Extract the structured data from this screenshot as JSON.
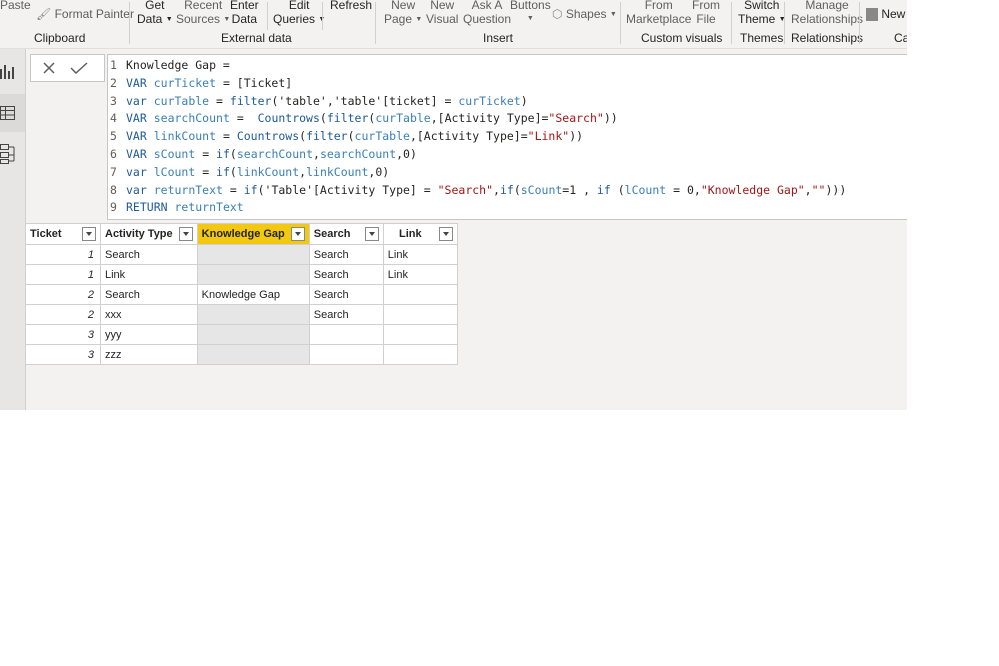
{
  "ribbon": {
    "paste": "Paste",
    "format_painter": "Format Painter",
    "get_data": [
      "Get",
      "Data"
    ],
    "recent_sources": [
      "Recent",
      "Sources"
    ],
    "enter_data": [
      "Enter",
      "Data"
    ],
    "edit_queries": [
      "Edit",
      "Queries"
    ],
    "refresh": "Refresh",
    "new_page": [
      "New",
      "Page"
    ],
    "new_visual": [
      "New",
      "Visual"
    ],
    "ask_question": [
      "Ask A",
      "Question"
    ],
    "buttons": "Buttons",
    "shapes": "Shapes",
    "from_marketplace": [
      "From",
      "Marketplace"
    ],
    "from_file": [
      "From",
      "File"
    ],
    "switch_theme": [
      "Switch",
      "Theme"
    ],
    "manage_relationships": [
      "Manage",
      "Relationships"
    ],
    "new": "New",
    "groups": {
      "clipboard": "Clipboard",
      "external_data": "External data",
      "insert": "Insert",
      "custom_visuals": "Custom visuals",
      "themes": "Themes",
      "relationships": "Relationships",
      "calc": "Ca"
    }
  },
  "nav": {
    "active": "data-view"
  },
  "formula": {
    "lines": [
      {
        "n": "1",
        "html": "Knowledge Gap ="
      },
      {
        "n": "2",
        "html": "<span class='kw'>VAR</span> <span class='var'>curTicket</span> = [Ticket]"
      },
      {
        "n": "3",
        "html": "<span class='kw'>var</span> <span class='var'>curTable</span> = <span class='fn'>filter</span>('table','table'[ticket] = <span class='var'>curTicket</span>)"
      },
      {
        "n": "4",
        "html": "<span class='kw'>VAR</span> <span class='var'>searchCount</span> =  <span class='fn'>Countrows</span>(<span class='fn'>filter</span>(<span class='var'>curTable</span>,[Activity Type]=<span class='str'>\"Search\"</span>))"
      },
      {
        "n": "5",
        "html": "<span class='kw'>VAR</span> <span class='var'>linkCount</span> = <span class='fn'>Countrows</span>(<span class='fn'>filter</span>(<span class='var'>curTable</span>,[Activity Type]=<span class='str'>\"Link\"</span>))"
      },
      {
        "n": "6",
        "html": "<span class='kw'>VAR</span> <span class='var'>sCount</span> = <span class='fn'>if</span>(<span class='var'>searchCount</span>,<span class='var'>searchCount</span>,0)"
      },
      {
        "n": "7",
        "html": "<span class='kw'>var</span> <span class='var'>lCount</span> = <span class='fn'>if</span>(<span class='var'>linkCount</span>,<span class='var'>linkCount</span>,0)"
      },
      {
        "n": "8",
        "html": "<span class='kw'>var</span> <span class='var'>returnText</span> = <span class='fn'>if</span>('Table'[Activity Type] = <span class='str'>\"Search\"</span>,<span class='fn'>if</span>(<span class='var'>sCount</span>=1 , <span class='fn'>if</span> (<span class='var'>lCount</span> = 0,<span class='str'>\"Knowledge Gap\"</span>,<span class='str'>\"\"</span>)))"
      },
      {
        "n": "9",
        "html": "<span class='kw'>RETURN</span> <span class='var'>returnText</span>"
      }
    ]
  },
  "table": {
    "columns": [
      "Ticket",
      "Activity Type",
      "Knowledge Gap",
      "Search",
      "Link"
    ],
    "rows": [
      [
        "1",
        "Search",
        "",
        "Search",
        "Link"
      ],
      [
        "1",
        "Link",
        "",
        "Search",
        "Link"
      ],
      [
        "2",
        "Search",
        "Knowledge Gap",
        "Search",
        ""
      ],
      [
        "2",
        "xxx",
        "",
        "Search",
        ""
      ],
      [
        "3",
        "yyy",
        "",
        "",
        ""
      ],
      [
        "3",
        "zzz",
        "",
        "",
        ""
      ]
    ]
  },
  "colors": {
    "selected_column": "#f2c811",
    "keyword": "#1f5a99",
    "string": "#a31515",
    "variable": "#3a7fb5"
  }
}
